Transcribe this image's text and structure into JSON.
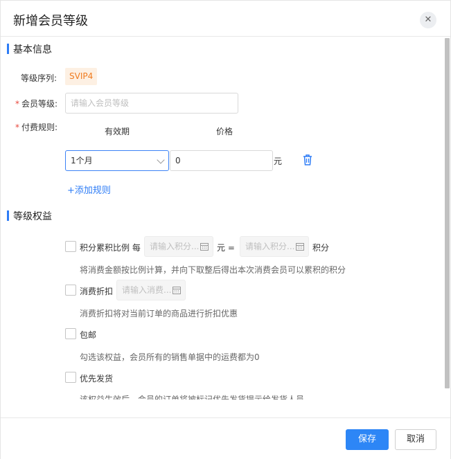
{
  "dialog": {
    "title": "新增会员等级",
    "close_glyph": "✕"
  },
  "basic_section": {
    "title": "基本信息",
    "level_seq_label": "等级序列:",
    "level_seq_value": "SVIP4",
    "member_level_label": "会员等级:",
    "member_level_placeholder": "请输入会员等级",
    "member_level_value": "",
    "fee_rule_label": "付费规则:",
    "required_mark": "*",
    "col_validity": "有效期",
    "col_price": "价格",
    "rules": [
      {
        "validity": "1个月",
        "price": "0",
        "unit": "元"
      }
    ],
    "add_rule_label": "+添加规则"
  },
  "benefits_section": {
    "title": "等级权益",
    "points_ratio": {
      "label": "积分累积比例 每",
      "placeholder_amount": "请输入积分...",
      "eq_text": "元 =",
      "placeholder_points": "请输入积分...",
      "unit": "积分",
      "desc": "将消费金额按比例计算，并向下取整后得出本次消费会员可以累积的积分",
      "checked": false
    },
    "discount": {
      "label": "消费折扣",
      "placeholder": "请输入消费...",
      "desc": "消费折扣将对当前订单的商品进行折扣优惠",
      "checked": false
    },
    "free_shipping": {
      "label": "包邮",
      "desc": "勾选该权益，会员所有的销售单据中的运费都为0",
      "checked": false
    },
    "priority_shipping": {
      "label": "优先发货",
      "desc": "该权益生效后，会员的订单将被标记优先发货提示给发货人员",
      "checked": false
    }
  },
  "footer": {
    "save_label": "保存",
    "cancel_label": "取消"
  },
  "icons": {
    "delete": "trash-icon",
    "calendar": "calendar-icon",
    "close": "close-icon",
    "dropdown": "chevron-down-icon"
  },
  "colors": {
    "primary": "#2d86f6",
    "required": "#e8483d",
    "badge_text": "#f07b1f",
    "badge_bg": "#fdf0e3"
  }
}
